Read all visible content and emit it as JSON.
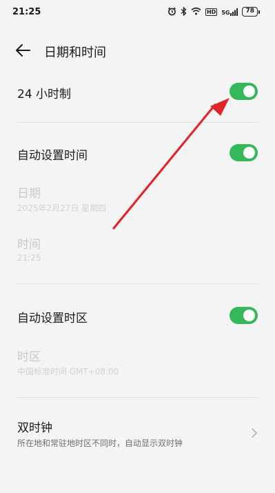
{
  "status_bar": {
    "time": "21:25",
    "icons": [
      "alarm-icon",
      "bluetooth-icon",
      "wifi-icon",
      "hd-badge-icon",
      "5g-signal-icon",
      "battery-icon"
    ],
    "hd_label": "HD",
    "signal_label": "5G",
    "battery_level": "78"
  },
  "header": {
    "title": "日期和时间",
    "back_icon": "back-arrow-icon"
  },
  "settings": {
    "hour24": {
      "label": "24 小时制",
      "enabled": true
    },
    "auto_time": {
      "label": "自动设置时间",
      "enabled": true
    },
    "date": {
      "label": "日期",
      "value": "2025年2月27日 星期四"
    },
    "time": {
      "label": "时间",
      "value": "21:25"
    },
    "auto_timezone": {
      "label": "自动设置时区",
      "enabled": true
    },
    "timezone": {
      "label": "时区",
      "value": "中国标准时间 GMT+08:00"
    },
    "dual_clock": {
      "label": "双时钟",
      "description": "所在地和常驻地时区不同时，自动显示双时钟"
    }
  },
  "colors": {
    "toggle_on": "#35b85a",
    "annotation_arrow": "#e0262a",
    "background": "#f4f4f4"
  },
  "annotation": {
    "type": "red-arrow",
    "points_to": "24-hour-toggle"
  }
}
